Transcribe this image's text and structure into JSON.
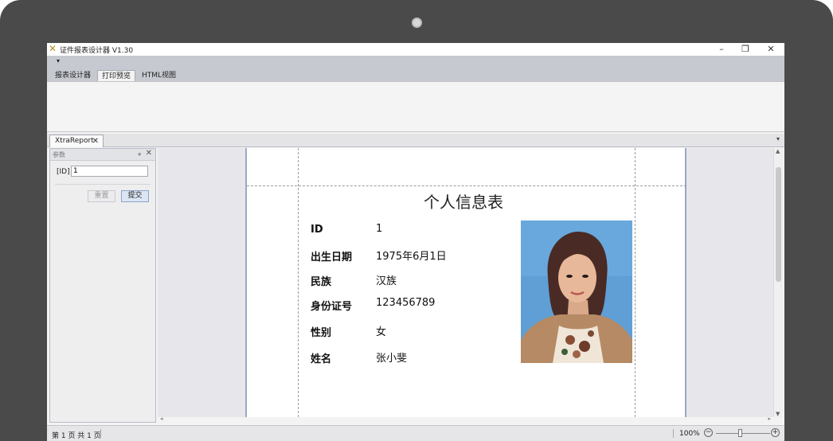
{
  "window": {
    "title": "证件报表设计器 V1.30",
    "minimize": "–",
    "restore": "❐",
    "close": "✕"
  },
  "quick_access": {
    "arrow": "▾"
  },
  "ribbon": {
    "tabs": [
      {
        "label": "报表设计器",
        "active": false
      },
      {
        "label": "打印预览",
        "active": true
      },
      {
        "label": "HTML视图",
        "active": false
      }
    ]
  },
  "document": {
    "tab_label": "XtraReport",
    "tab_close": "✕",
    "tabs_menu": "▾"
  },
  "parameters_panel": {
    "title": "参数",
    "pin": "ᵩ",
    "close": "✕",
    "id_label": "[ID]",
    "id_value": "1",
    "reset_label": "重置",
    "submit_label": "提交"
  },
  "report": {
    "title": "个人信息表",
    "fields": [
      {
        "label": "ID",
        "value": "1"
      },
      {
        "label": "出生日期",
        "value": "1975年6月1日"
      },
      {
        "label": "民族",
        "value": "汉族"
      },
      {
        "label": "身份证号",
        "value": "123456789"
      },
      {
        "label": "性别",
        "value": "女"
      },
      {
        "label": "姓名",
        "value": "张小斐"
      }
    ],
    "photo_icon": "portrait-photo"
  },
  "scroll": {
    "up": "▲",
    "down": "▼",
    "left": "◂",
    "right": "▸"
  },
  "status": {
    "page_info": "第 1 页 共 1 页",
    "zoom": "100%",
    "zoom_minus": "−",
    "zoom_plus": "+",
    "zoom_level": 0.5
  },
  "colors": {
    "accent": "#dbe5f4",
    "photo_background": "#6aa8dc"
  }
}
